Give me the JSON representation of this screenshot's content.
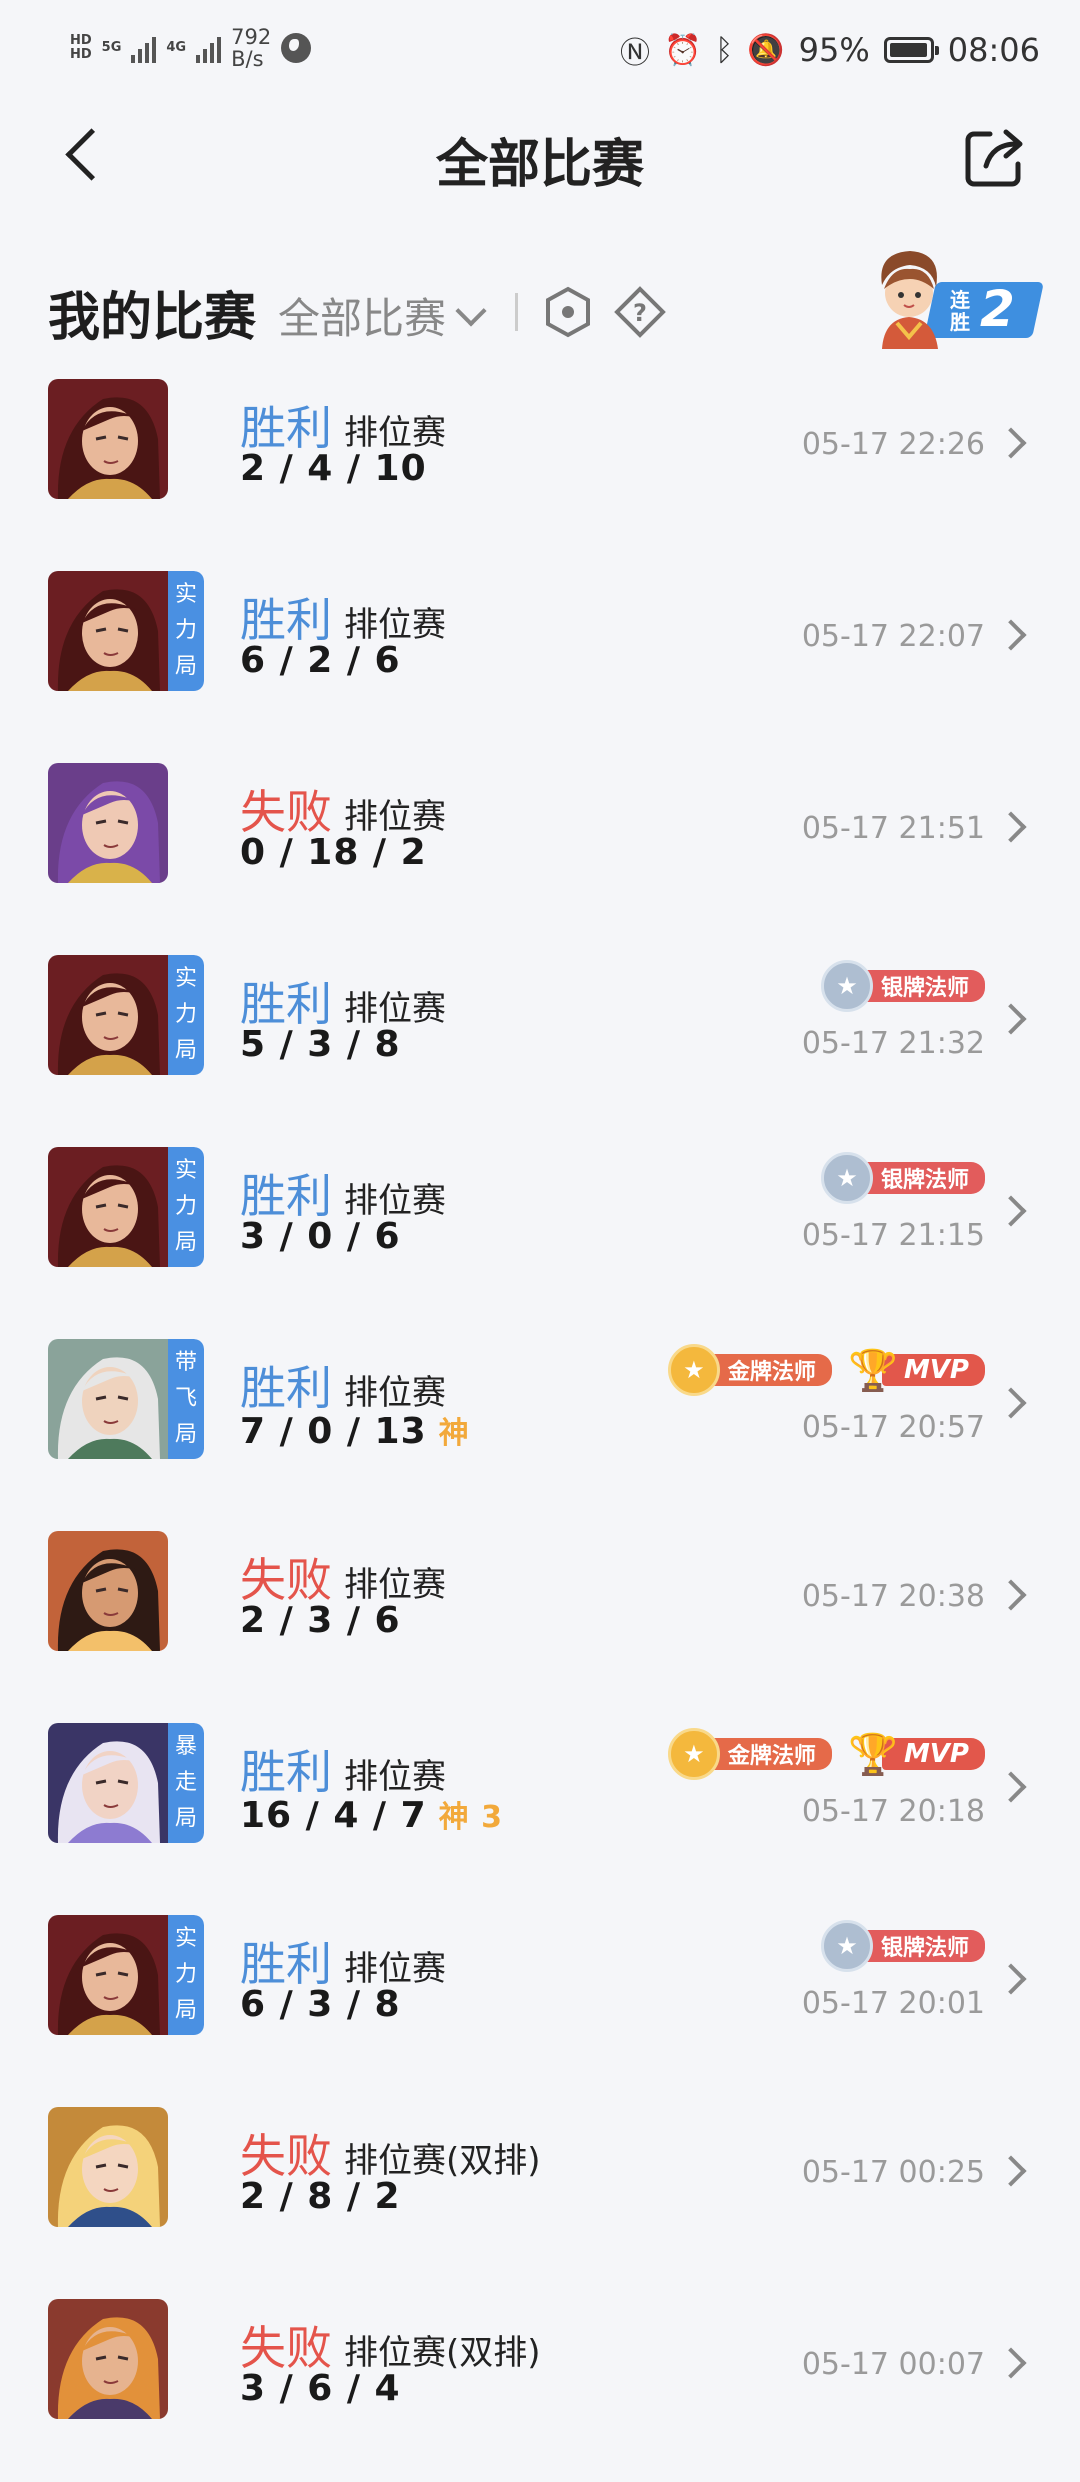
{
  "status_bar": {
    "sim1": "HD",
    "sim2": "HD",
    "net1": "5G",
    "net2": "4G",
    "speed_value": "792",
    "speed_unit": "B/s",
    "battery": "95%",
    "time": "08:06",
    "icons": [
      "nfc-icon",
      "alarm-icon",
      "bluetooth-icon",
      "vibrate-icon",
      "mute-icon"
    ]
  },
  "header": {
    "title": "全部比赛"
  },
  "filter": {
    "my_title": "我的比赛",
    "scope": "全部比赛"
  },
  "streak": {
    "label": "连胜",
    "count": "2"
  },
  "colors": {
    "win": "#4d8ed8",
    "lose": "#e4544b",
    "tag_blue": "#4a90e2",
    "god_orange": "#f2a93b"
  },
  "matches": [
    {
      "result": "胜利",
      "mode": "排位赛",
      "kda": "2 / 4 / 10",
      "time": "05-17 22:26",
      "tag": "",
      "god": "",
      "badges": []
    },
    {
      "result": "胜利",
      "mode": "排位赛",
      "kda": "6 / 2 / 6",
      "time": "05-17 22:07",
      "tag": "实力局",
      "god": "",
      "badges": []
    },
    {
      "result": "失败",
      "mode": "排位赛",
      "kda": "0 / 18 / 2",
      "time": "05-17 21:51",
      "tag": "",
      "god": "",
      "badges": []
    },
    {
      "result": "胜利",
      "mode": "排位赛",
      "kda": "5 / 3 / 8",
      "time": "05-17 21:32",
      "tag": "实力局",
      "god": "",
      "badges": [
        "银牌法师"
      ]
    },
    {
      "result": "胜利",
      "mode": "排位赛",
      "kda": "3 / 0 / 6",
      "time": "05-17 21:15",
      "tag": "实力局",
      "god": "",
      "badges": [
        "银牌法师"
      ]
    },
    {
      "result": "胜利",
      "mode": "排位赛",
      "kda": "7 / 0 / 13",
      "time": "05-17 20:57",
      "tag": "带飞局",
      "god": "神",
      "badges": [
        "金牌法师",
        "MVP"
      ]
    },
    {
      "result": "失败",
      "mode": "排位赛",
      "kda": "2 / 3 / 6",
      "time": "05-17 20:38",
      "tag": "",
      "god": "",
      "badges": []
    },
    {
      "result": "胜利",
      "mode": "排位赛",
      "kda": "16 / 4 / 7",
      "time": "05-17 20:18",
      "tag": "暴走局",
      "god": "神 3",
      "badges": [
        "金牌法师",
        "MVP"
      ]
    },
    {
      "result": "胜利",
      "mode": "排位赛",
      "kda": "6 / 3 / 8",
      "time": "05-17 20:01",
      "tag": "实力局",
      "god": "",
      "badges": [
        "银牌法师"
      ]
    },
    {
      "result": "失败",
      "mode": "排位赛(双排)",
      "kda": "2 / 8 / 2",
      "time": "05-17 00:25",
      "tag": "",
      "god": "",
      "badges": []
    },
    {
      "result": "失败",
      "mode": "排位赛(双排)",
      "kda": "3 / 6 / 4",
      "time": "05-17 00:07",
      "tag": "",
      "god": "",
      "badges": []
    }
  ]
}
